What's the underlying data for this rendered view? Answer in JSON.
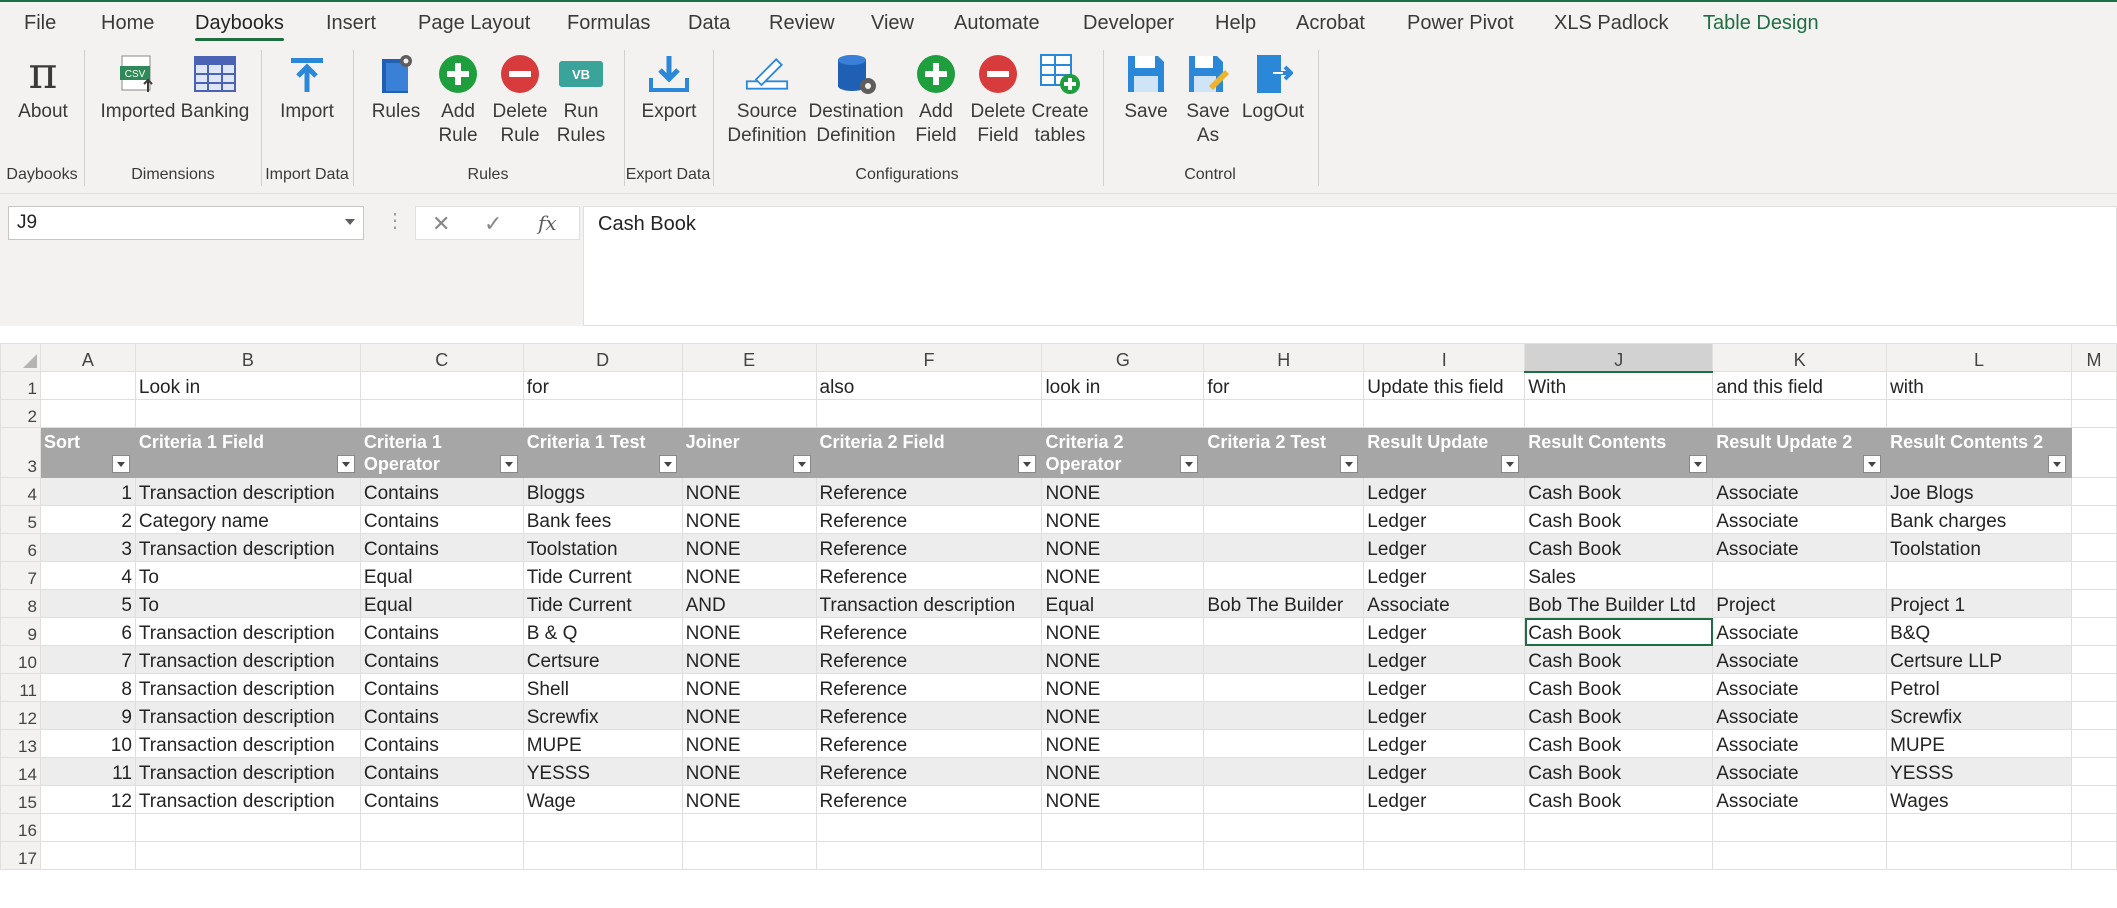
{
  "ribbon": {
    "tabs": [
      "File",
      "Home",
      "Daybooks",
      "Insert",
      "Page Layout",
      "Formulas",
      "Data",
      "Review",
      "View",
      "Automate",
      "Developer",
      "Help",
      "Acrobat",
      "Power Pivot",
      "XLS Padlock",
      "Table Design"
    ],
    "active_tab": "Daybooks",
    "buttons": {
      "about": "About",
      "imported": "Imported",
      "banking": "Banking",
      "import": "Import",
      "rules": "Rules",
      "add_rule": "Add\nRule",
      "delete_rule": "Delete\nRule",
      "run_rules": "Run\nRules",
      "export": "Export",
      "source_definition": "Source\nDefinition",
      "destination_definition": "Destination\nDefinition",
      "add_field": "Add\nField",
      "delete_field": "Delete\nField",
      "create_tables": "Create\ntables",
      "save": "Save",
      "save_as": "Save\nAs",
      "logout": "LogOut"
    },
    "groups": {
      "daybooks": "Daybooks",
      "dimensions": "Dimensions",
      "import_data": "Import Data",
      "rules": "Rules",
      "export_data": "Export Data",
      "configurations": "Configurations",
      "control": "Control"
    },
    "icons": {
      "vb_badge": "VB",
      "csv_badge": "CSV",
      "pi_glyph": "π"
    }
  },
  "formula_bar": {
    "name_box": "J9",
    "formula": "Cash Book",
    "fx_label": "fx"
  },
  "sheet": {
    "columns": [
      "A",
      "B",
      "C",
      "D",
      "E",
      "F",
      "G",
      "H",
      "I",
      "J",
      "K",
      "L",
      "M"
    ],
    "selected_column": "J",
    "row_numbers": [
      "1",
      "2",
      "3",
      "4",
      "5",
      "6",
      "7",
      "8",
      "9",
      "10",
      "11",
      "12",
      "13",
      "14",
      "15",
      "16",
      "17"
    ],
    "row1": [
      "",
      "Look in",
      "",
      "for",
      "",
      "also",
      "look in",
      "for",
      "Update this field",
      "With",
      "and this field",
      "with"
    ],
    "table_headers": [
      "Sort",
      "Criteria 1 Field",
      "Criteria 1 Operator",
      "Criteria 1 Test",
      "Joiner",
      "Criteria 2 Field",
      "Criteria 2 Operator",
      "Criteria 2 Test",
      "Result Update",
      "Result Contents",
      "Result Update 2",
      "Result Contents 2"
    ],
    "rows": [
      [
        "1",
        "Transaction description",
        "Contains",
        "Bloggs",
        "NONE",
        "Reference",
        "NONE",
        "",
        "Ledger",
        "Cash Book",
        "Associate",
        "Joe Blogs"
      ],
      [
        "2",
        "Category name",
        "Contains",
        "Bank fees",
        "NONE",
        "Reference",
        "NONE",
        "",
        "Ledger",
        "Cash Book",
        "Associate",
        "Bank charges"
      ],
      [
        "3",
        "Transaction description",
        "Contains",
        "Toolstation",
        "NONE",
        "Reference",
        "NONE",
        "",
        "Ledger",
        "Cash Book",
        "Associate",
        "Toolstation"
      ],
      [
        "4",
        "To",
        "Equal",
        "Tide Current",
        "NONE",
        "Reference",
        "NONE",
        "",
        "Ledger",
        "Sales",
        "",
        ""
      ],
      [
        "5",
        "To",
        "Equal",
        "Tide Current",
        "AND",
        "Transaction description",
        "Equal",
        "Bob The Builder",
        "Associate",
        "Bob The Builder Ltd",
        "Project",
        "Project 1"
      ],
      [
        "6",
        "Transaction description",
        "Contains",
        "B & Q",
        "NONE",
        "Reference",
        "NONE",
        "",
        "Ledger",
        "Cash Book",
        "Associate",
        "B&Q"
      ],
      [
        "7",
        "Transaction description",
        "Contains",
        "Certsure",
        "NONE",
        "Reference",
        "NONE",
        "",
        "Ledger",
        "Cash Book",
        "Associate",
        "Certsure LLP"
      ],
      [
        "8",
        "Transaction description",
        "Contains",
        "Shell",
        "NONE",
        "Reference",
        "NONE",
        "",
        "Ledger",
        "Cash Book",
        "Associate",
        "Petrol"
      ],
      [
        "9",
        "Transaction description",
        "Contains",
        "Screwfix",
        "NONE",
        "Reference",
        "NONE",
        "",
        "Ledger",
        "Cash Book",
        "Associate",
        "Screwfix"
      ],
      [
        "10",
        "Transaction description",
        "Contains",
        "MUPE",
        "NONE",
        "Reference",
        "NONE",
        "",
        "Ledger",
        "Cash Book",
        "Associate",
        "MUPE"
      ],
      [
        "11",
        "Transaction description",
        "Contains",
        "YESSS",
        "NONE",
        "Reference",
        "NONE",
        "",
        "Ledger",
        "Cash Book",
        "Associate",
        "YESSS"
      ],
      [
        "12",
        "Transaction description",
        "Contains",
        "Wage",
        "NONE",
        "Reference",
        "NONE",
        "",
        "Ledger",
        "Cash Book",
        "Associate",
        "Wages"
      ]
    ],
    "selected_cell": {
      "row": 9,
      "col": "J"
    }
  }
}
